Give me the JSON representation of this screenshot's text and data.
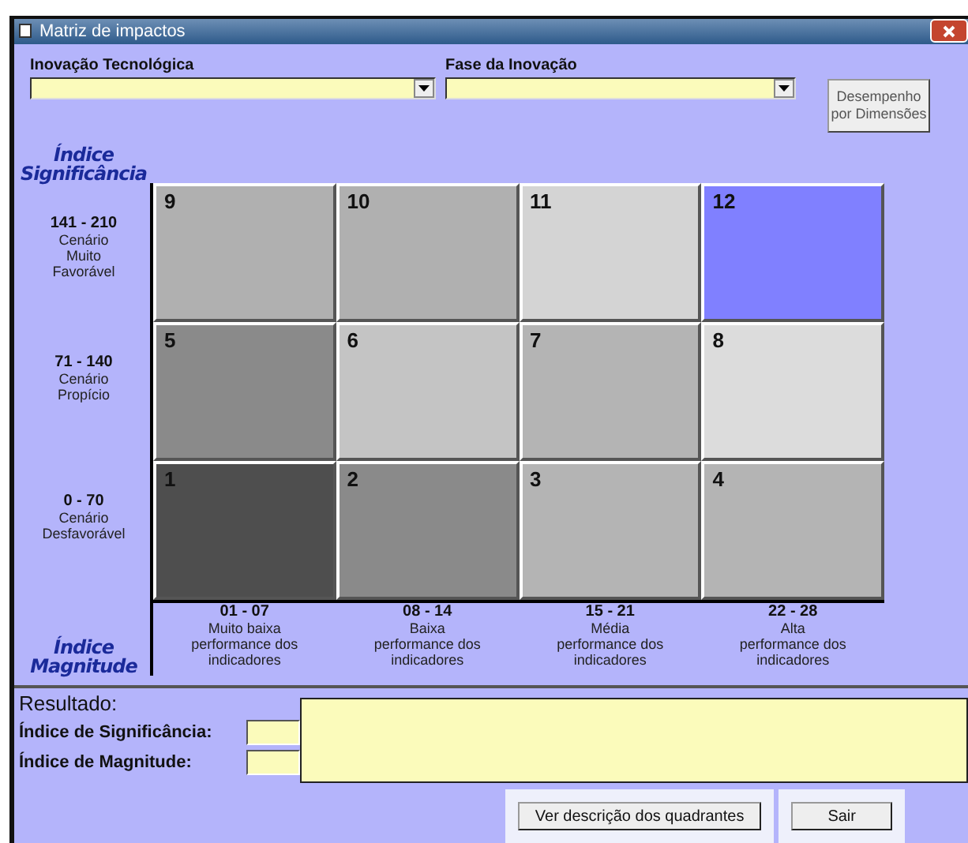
{
  "window": {
    "title": "Matriz de impactos"
  },
  "filters": [
    {
      "label": "Inovação Tecnológica"
    },
    {
      "label": "Fase da Inovação"
    }
  ],
  "dimension_button": "Desempenho por Dimensões",
  "matrix": {
    "y_axis_title": [
      "Índice",
      "Significância"
    ],
    "x_axis_title": [
      "Índice",
      "Magnitude"
    ],
    "significance_bands": [
      {
        "range": "141 - 210",
        "description": [
          "Cenário",
          "Muito",
          "Favorável"
        ],
        "cells": [
          {
            "number": "9",
            "color": "#b0b0b0"
          },
          {
            "number": "10",
            "color": "#b0b0b0"
          },
          {
            "number": "11",
            "color": "#d4d4d4"
          },
          {
            "number": "12",
            "color": "#8080ff"
          }
        ]
      },
      {
        "range": "71 - 140",
        "description": [
          "Cenário",
          "Propício"
        ],
        "cells": [
          {
            "number": "5",
            "color": "#8a8a8a"
          },
          {
            "number": "6",
            "color": "#c4c4c4"
          },
          {
            "number": "7",
            "color": "#b4b4b4"
          },
          {
            "number": "8",
            "color": "#dcdcdc"
          }
        ]
      },
      {
        "range": "0 - 70",
        "description": [
          "Cenário",
          "Desfavorável"
        ],
        "cells": [
          {
            "number": "1",
            "color": "#4e4e4e"
          },
          {
            "number": "2",
            "color": "#8a8a8a"
          },
          {
            "number": "3",
            "color": "#b4b4b4"
          },
          {
            "number": "4",
            "color": "#b4b4b4"
          }
        ]
      }
    ],
    "magnitude_bands": [
      {
        "range": "01 - 07",
        "description": [
          "Muito baixa",
          "performance dos",
          "indicadores"
        ]
      },
      {
        "range": "08 - 14",
        "description": [
          "Baixa",
          "performance dos",
          "indicadores"
        ]
      },
      {
        "range": "15 - 21",
        "description": [
          "Média",
          "performance dos",
          "indicadores"
        ]
      },
      {
        "range": "22 - 28",
        "description": [
          "Alta",
          "performance dos",
          "indicadores"
        ]
      }
    ]
  },
  "result": {
    "title": "Resultado:",
    "fields": [
      {
        "label": "Índice de Significância:"
      },
      {
        "label": "Índice de Magnitude:"
      }
    ]
  },
  "buttons": [
    "Ver descrição dos quadrantes",
    "Sair"
  ]
}
